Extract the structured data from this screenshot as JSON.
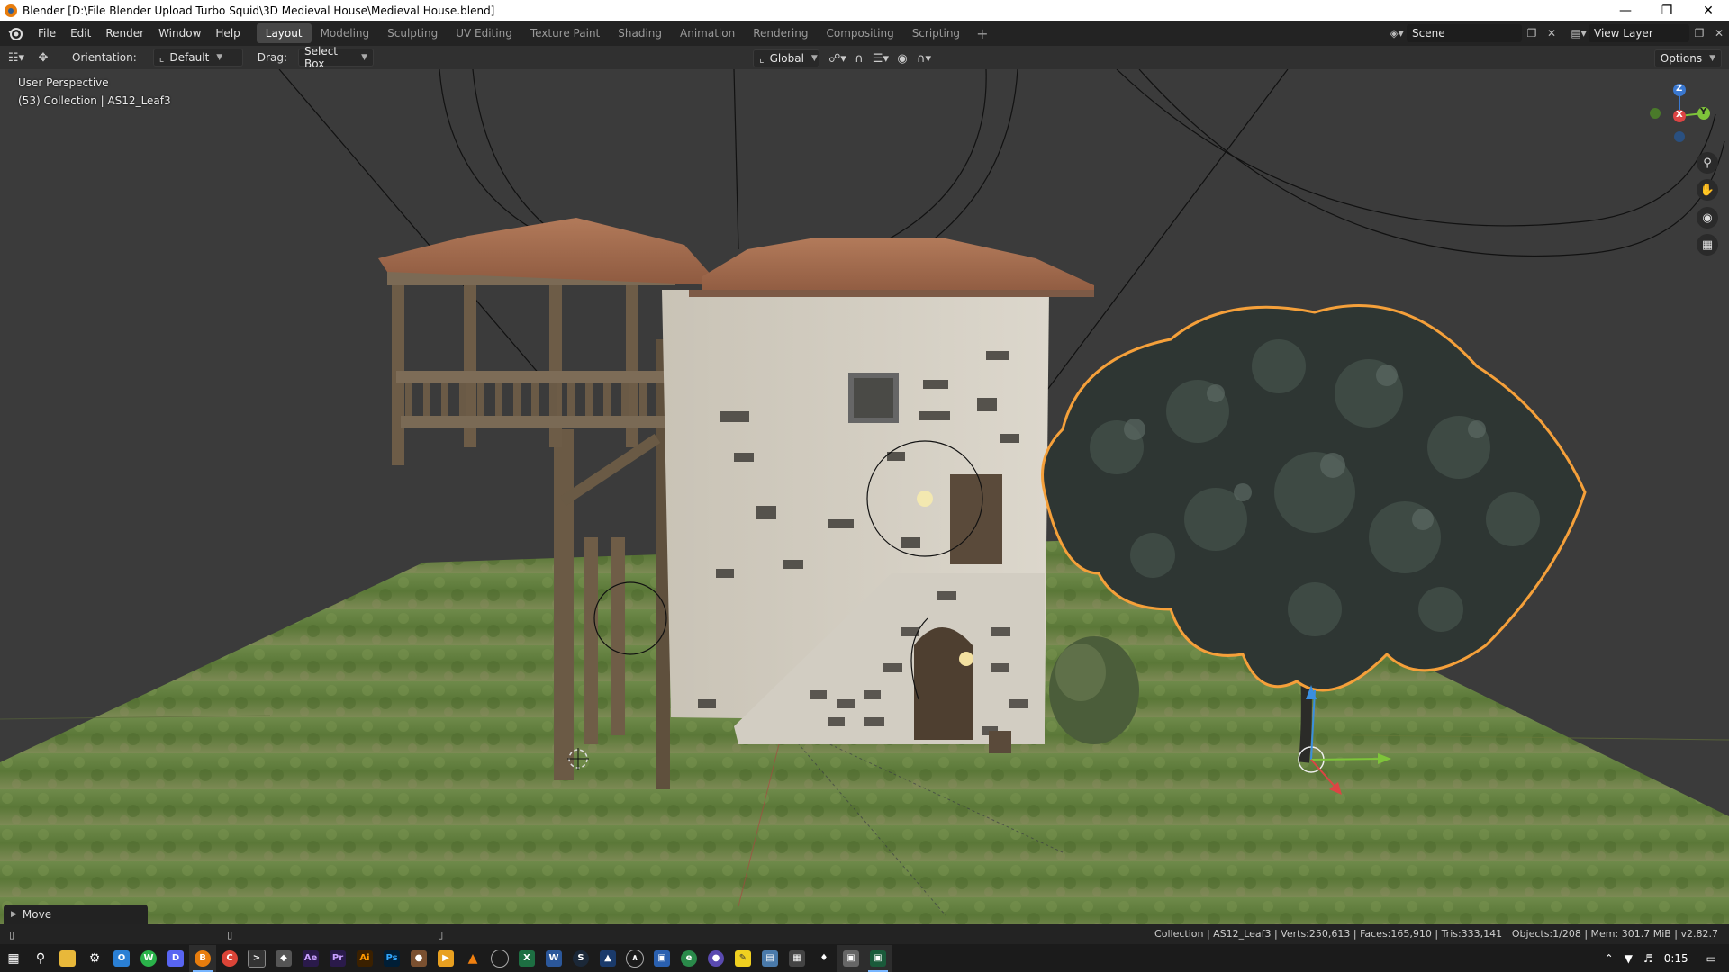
{
  "window": {
    "title": "Blender [D:\\File Blender Upload Turbo Squid\\3D Medieval House\\Medieval House.blend]"
  },
  "menu": [
    "File",
    "Edit",
    "Render",
    "Window",
    "Help"
  ],
  "workspaces": [
    "Layout",
    "Modeling",
    "Sculpting",
    "UV Editing",
    "Texture Paint",
    "Shading",
    "Animation",
    "Rendering",
    "Compositing",
    "Scripting"
  ],
  "active_workspace": "Layout",
  "scene": {
    "scene_name": "Scene",
    "view_layer": "View Layer"
  },
  "header": {
    "orientation_label": "Orientation:",
    "orientation_value": "Default",
    "drag_label": "Drag:",
    "drag_value": "Select Box",
    "transform_orientation": "Global",
    "options": "Options"
  },
  "viewport": {
    "perspective": "User Perspective",
    "collection_info": "(53) Collection | AS12_Leaf3",
    "gizmo_axes": [
      "X",
      "Y",
      "Z"
    ]
  },
  "operator_panel": {
    "label": "Move"
  },
  "status": {
    "stats": "Collection | AS12_Leaf3 | Verts:250,613 | Faces:165,910 | Tris:333,141 | Objects:1/208 | Mem: 301.7 MiB | v2.82.7"
  },
  "taskbar": {
    "apps": [
      "start",
      "search",
      "file-explorer",
      "settings",
      "outlook",
      "whatsapp",
      "discord",
      "blender",
      "chrome",
      "terminal",
      "app",
      "after-effects",
      "premiere",
      "illustrator",
      "photoshop",
      "app",
      "media",
      "vlc",
      "app",
      "excel",
      "word",
      "steam",
      "app",
      "app",
      "app",
      "app",
      "app",
      "sticky-notes",
      "files",
      "calculator",
      "app",
      "app",
      "app"
    ],
    "clock": "0:15"
  },
  "colors": {
    "accent": "#e87d0d",
    "active_tab": "#474747",
    "grass": "#5a7a3a",
    "selection": "#f5a03a"
  }
}
